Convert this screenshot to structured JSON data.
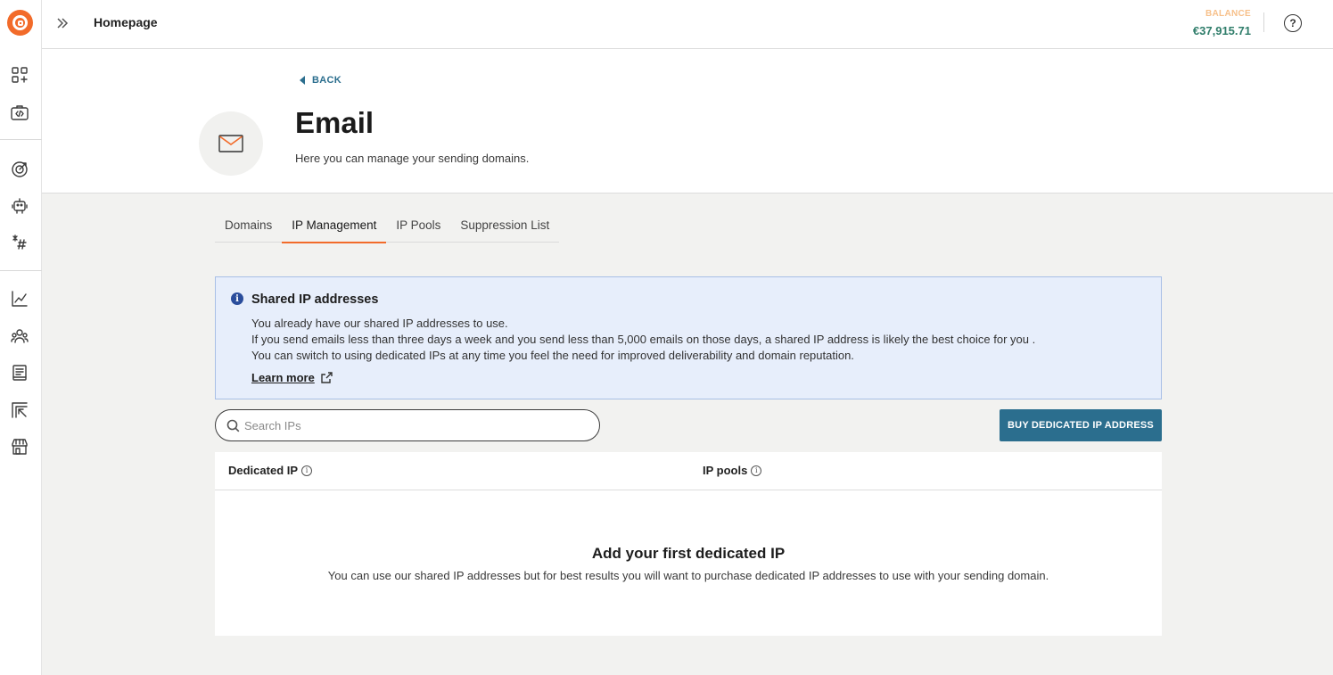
{
  "topbar": {
    "breadcrumb": "Homepage",
    "balance_label": "BALANCE",
    "balance_value": "€37,915.71",
    "help_symbol": "?"
  },
  "sidebar": {
    "icons": [
      "apps-add-icon",
      "code-briefcase-icon",
      "target-icon",
      "robot-icon",
      "hashtag-icon",
      "chart-line-icon",
      "users-icon",
      "book-icon",
      "import-icon",
      "store-icon"
    ]
  },
  "header": {
    "back_label": "BACK",
    "title": "Email",
    "subtitle": "Here you can manage your sending domains."
  },
  "tabs": [
    {
      "label": "Domains",
      "active": false
    },
    {
      "label": "IP Management",
      "active": true
    },
    {
      "label": "IP Pools",
      "active": false
    },
    {
      "label": "Suppression List",
      "active": false
    }
  ],
  "info": {
    "title": "Shared IP addresses",
    "lines": [
      "You already have our shared IP addresses to use.",
      "If you send emails less than three days a week and you send less than 5,000 emails on those days, a shared IP address is likely the best choice for you .",
      "You can switch to using dedicated IPs at any time you feel the need for improved deliverability and domain reputation."
    ],
    "learn_more": "Learn more"
  },
  "search": {
    "placeholder": "Search IPs",
    "value": ""
  },
  "actions": {
    "buy_label": "BUY DEDICATED IP ADDRESS"
  },
  "table": {
    "columns": [
      "Dedicated IP",
      "IP pools"
    ],
    "empty_title": "Add your first dedicated IP",
    "empty_text": "You can use our shared IP addresses but for best results you will want to purchase dedicated IP addresses to use with your sending domain."
  },
  "colors": {
    "brand": "#f26b2a",
    "primary": "#2b6e8e",
    "balance": "#2f7d6a",
    "info_bg": "#e7eefb"
  }
}
